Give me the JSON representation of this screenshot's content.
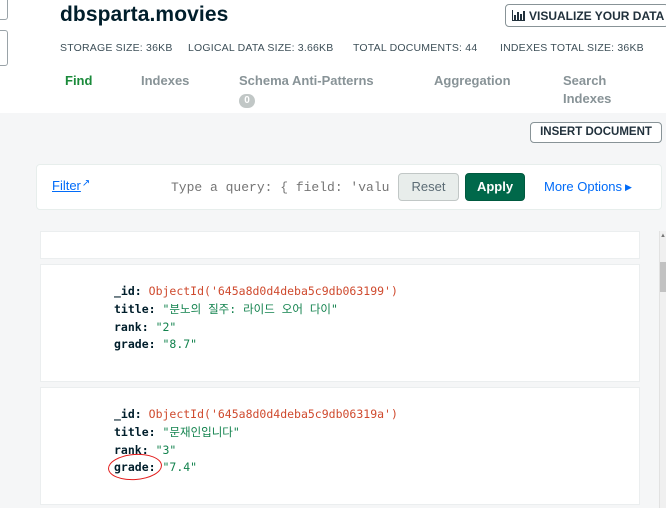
{
  "database": {
    "title": "dbsparta.movies"
  },
  "header": {
    "visualize_label": "VISUALIZE YOUR DATA",
    "visualize_icon": "bar-chart-icon"
  },
  "stats": {
    "storage": "STORAGE SIZE: 36KB",
    "logical": "LOGICAL DATA SIZE: 3.66KB",
    "documents": "TOTAL DOCUMENTS: 44",
    "indexes": "INDEXES TOTAL SIZE: 36KB"
  },
  "tabs": [
    {
      "label": "Find",
      "active": true
    },
    {
      "label": "Indexes"
    },
    {
      "label": "Schema Anti-Patterns",
      "badge": "0"
    },
    {
      "label": "Aggregation"
    },
    {
      "label": "Search Indexes"
    }
  ],
  "toolbar": {
    "insert_label": "INSERT DOCUMENT"
  },
  "query": {
    "filter_label": "Filter",
    "placeholder": "Type a query: { field: 'value' }",
    "reset_label": "Reset",
    "apply_label": "Apply",
    "more_options_label": "More Options"
  },
  "documents": [
    {
      "fields": [
        {
          "key": "_id",
          "value": "ObjectId('645a8d0d4deba5c9db063199')"
        },
        {
          "key": "title",
          "value": "\"분노의 질주: 라이드 오어 다이\""
        },
        {
          "key": "rank",
          "value": "\"2\""
        },
        {
          "key": "grade",
          "value": "\"8.7\""
        }
      ]
    },
    {
      "fields": [
        {
          "key": "_id",
          "value": "ObjectId('645a8d0d4deba5c9db06319a')"
        },
        {
          "key": "title",
          "value": "\"문재인입니다\""
        },
        {
          "key": "rank",
          "value": "\"3\""
        },
        {
          "key": "grade",
          "value": "\"7.4\""
        }
      ]
    }
  ],
  "colors": {
    "accent_green": "#00684a",
    "link_blue": "#016bf8",
    "annotation_red": "#e21b1b"
  }
}
